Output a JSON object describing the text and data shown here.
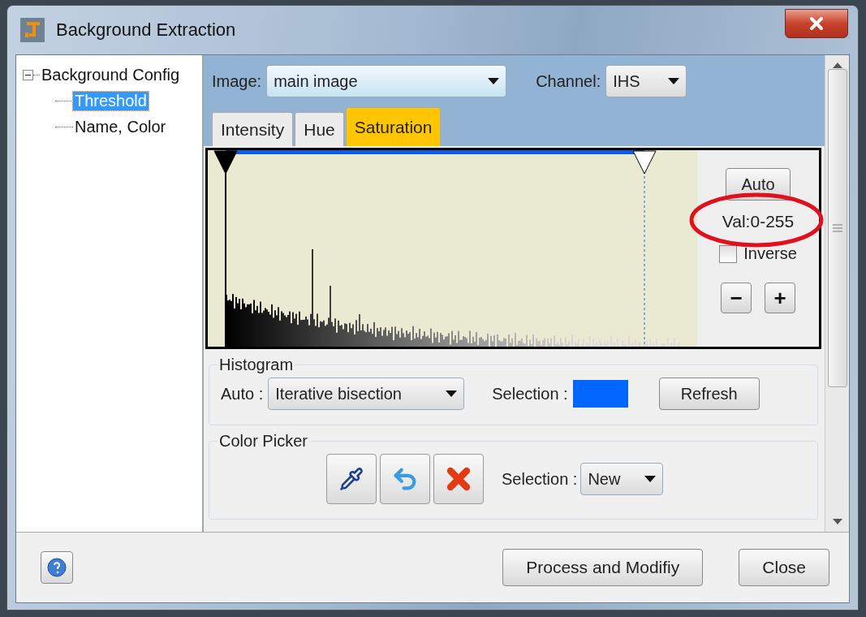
{
  "window": {
    "title": "Background Extraction"
  },
  "tree": [
    {
      "label": "Background Config",
      "expanded": true,
      "selected": false,
      "children": [
        {
          "label": "Threshold",
          "selected": true
        },
        {
          "label": "Name, Color",
          "selected": false
        }
      ]
    }
  ],
  "image": {
    "label": "Image:",
    "value": "main image"
  },
  "channel": {
    "label": "Channel:",
    "value": "IHS"
  },
  "tabs": [
    {
      "label": "Intensity",
      "selected": false
    },
    {
      "label": "Hue",
      "selected": false
    },
    {
      "label": "Saturation",
      "selected": true
    }
  ],
  "threshold": {
    "auto_button": "Auto",
    "value_text": "Val:0-255",
    "inverse": {
      "label": "Inverse",
      "checked": false
    },
    "minus": "−",
    "plus": "+"
  },
  "histogram_group": {
    "title": "Histogram",
    "auto_label": "Auto :",
    "auto_value": "Iterative bisection",
    "selection_label": "Selection :",
    "refresh_button": "Refresh"
  },
  "color_picker_group": {
    "title": "Color Picker",
    "selection_label": "Selection :",
    "selection_value": "New"
  },
  "footer": {
    "buttons": [
      "Process and Modifiy",
      "Close"
    ]
  }
}
